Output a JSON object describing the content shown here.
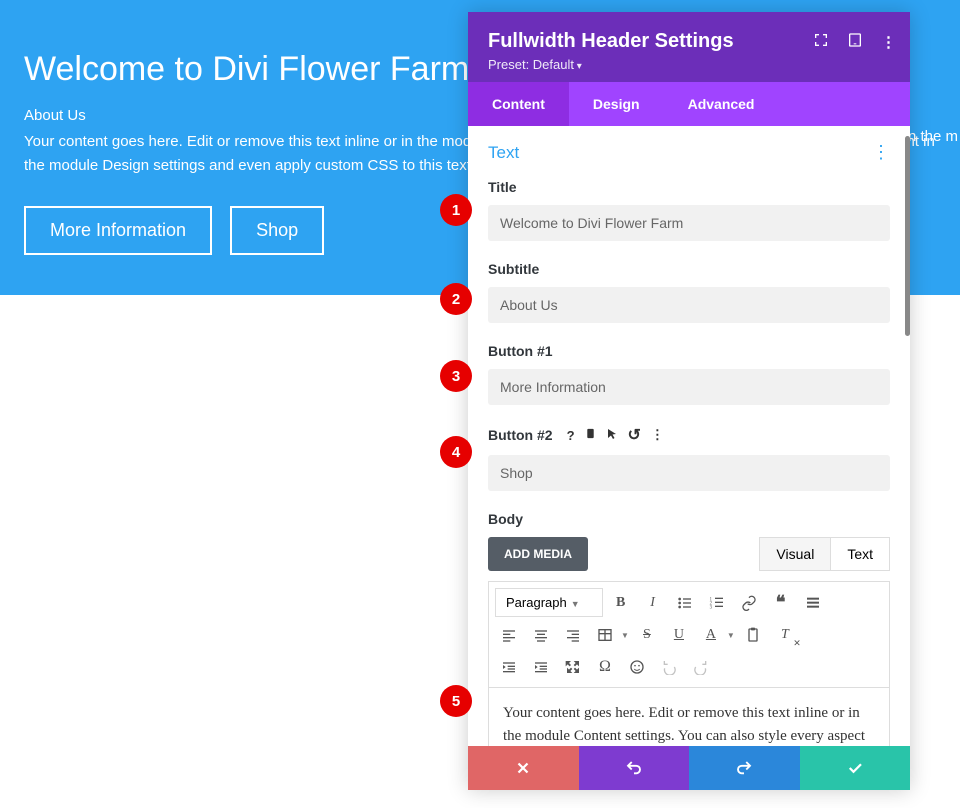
{
  "hero": {
    "title": "Welcome to Divi Flower Farm",
    "subtitle": "About Us",
    "body": "Your content goes here. Edit or remove this text inline or in the module Content settings. You can also style every aspect of this content in the module Design settings and even apply custom CSS to this text in the module Advanced settings.",
    "button1": "More Information",
    "button2": "Shop",
    "bgTextRight": "n the m"
  },
  "panel": {
    "title": "Fullwidth Header Settings",
    "preset": "Preset: Default",
    "tabs": {
      "content": "Content",
      "design": "Design",
      "advanced": "Advanced"
    },
    "section": "Text",
    "fields": {
      "titleLabel": "Title",
      "titleValue": "Welcome to Divi Flower Farm",
      "subtitleLabel": "Subtitle",
      "subtitleValue": "About Us",
      "button1Label": "Button #1",
      "button1Value": "More Information",
      "button2Label": "Button #2",
      "button2Value": "Shop",
      "bodyLabel": "Body"
    },
    "labelIcons": {
      "help": "?",
      "phone": "📱",
      "cursor": "↖",
      "reset": "↺",
      "more": "⋮"
    },
    "editor": {
      "addMedia": "ADD MEDIA",
      "visualTab": "Visual",
      "textTab": "Text",
      "format": "Paragraph",
      "body": "Your content goes here. Edit or remove this text inline or in the module Content settings. You can also style every aspect of this content in the module Design settings and even apply custom"
    }
  },
  "callouts": {
    "1": "1",
    "2": "2",
    "3": "3",
    "4": "4",
    "5": "5"
  }
}
